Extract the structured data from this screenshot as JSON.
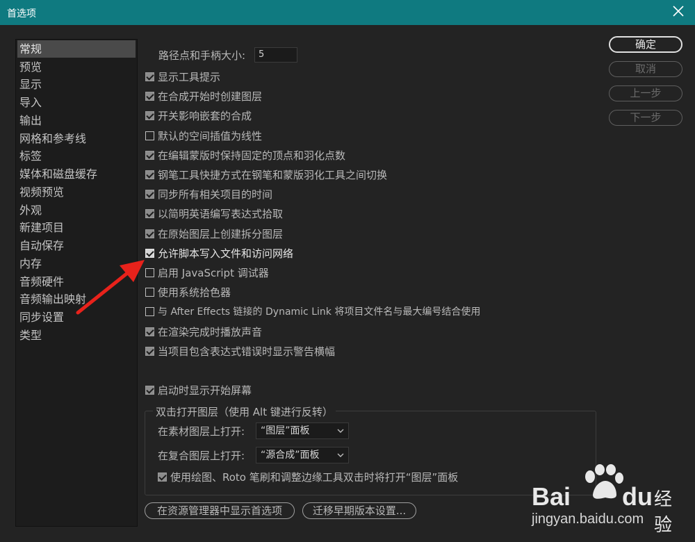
{
  "window": {
    "title": "首选项"
  },
  "sidebar": {
    "items": [
      {
        "label": "常规",
        "selected": true
      },
      {
        "label": "预览"
      },
      {
        "label": "显示"
      },
      {
        "label": "导入"
      },
      {
        "label": "输出"
      },
      {
        "label": "网格和参考线"
      },
      {
        "label": "标签"
      },
      {
        "label": "媒体和磁盘缓存"
      },
      {
        "label": "视频预览"
      },
      {
        "label": "外观"
      },
      {
        "label": "新建项目"
      },
      {
        "label": "自动保存"
      },
      {
        "label": "内存"
      },
      {
        "label": "音频硬件"
      },
      {
        "label": "音频输出映射"
      },
      {
        "label": "同步设置"
      },
      {
        "label": "类型"
      }
    ]
  },
  "general": {
    "path_size_label": "路径点和手柄大小:",
    "path_size_value": "5",
    "options": [
      {
        "label": "显示工具提示",
        "checked": true
      },
      {
        "label": "在合成开始时创建图层",
        "checked": true
      },
      {
        "label": "开关影响嵌套的合成",
        "checked": true
      },
      {
        "label": "默认的空间插值为线性",
        "checked": false
      },
      {
        "label": "在编辑蒙版时保持固定的顶点和羽化点数",
        "checked": true
      },
      {
        "label": "钢笔工具快捷方式在钢笔和蒙版羽化工具之间切换",
        "checked": true
      },
      {
        "label": "同步所有相关项目的时间",
        "checked": true
      },
      {
        "label": "以简明英语编写表达式拾取",
        "checked": true
      },
      {
        "label": "在原始图层上创建拆分图层",
        "checked": true
      },
      {
        "label": "允许脚本写入文件和访问网络",
        "checked": true,
        "highlight": true
      },
      {
        "label": "启用 JavaScript 调试器",
        "checked": false
      },
      {
        "label": "使用系统拾色器",
        "checked": false
      },
      {
        "label": "与 After Effects 链接的 Dynamic Link 将项目文件名与最大编号结合使用",
        "checked": false
      },
      {
        "label": "在渲染完成时播放声音",
        "checked": true
      },
      {
        "label": "当项目包含表达式错误时显示警告横幅",
        "checked": true
      }
    ],
    "startup_screen": {
      "label": "启动时显示开始屏幕",
      "checked": true
    },
    "double_click_group": {
      "title": "双击打开图层（使用 Alt 键进行反转）",
      "footage_label": "在素材图层上打开:",
      "footage_value": "“图层”面板",
      "comp_label": "在复合图层上打开:",
      "comp_value": "“源合成”面板",
      "paint_option": {
        "label": "使用绘图、Roto 笔刷和调整边缘工具双击时将打开“图层”面板",
        "checked": true
      }
    }
  },
  "buttons": {
    "ok": "确定",
    "cancel": "取消",
    "prev": "上一步",
    "next": "下一步",
    "reveal": "在资源管理器中显示首选项",
    "migrate": "迁移早期版本设置..."
  },
  "annotation": {
    "arrow_color": "#e8221b"
  },
  "watermark": {
    "brand_left": "Bai",
    "brand_right": "du",
    "brand_cn": "经验",
    "url": "jingyan.baidu.com"
  },
  "colors": {
    "titlebar": "#0f7a80",
    "background": "#232323"
  }
}
